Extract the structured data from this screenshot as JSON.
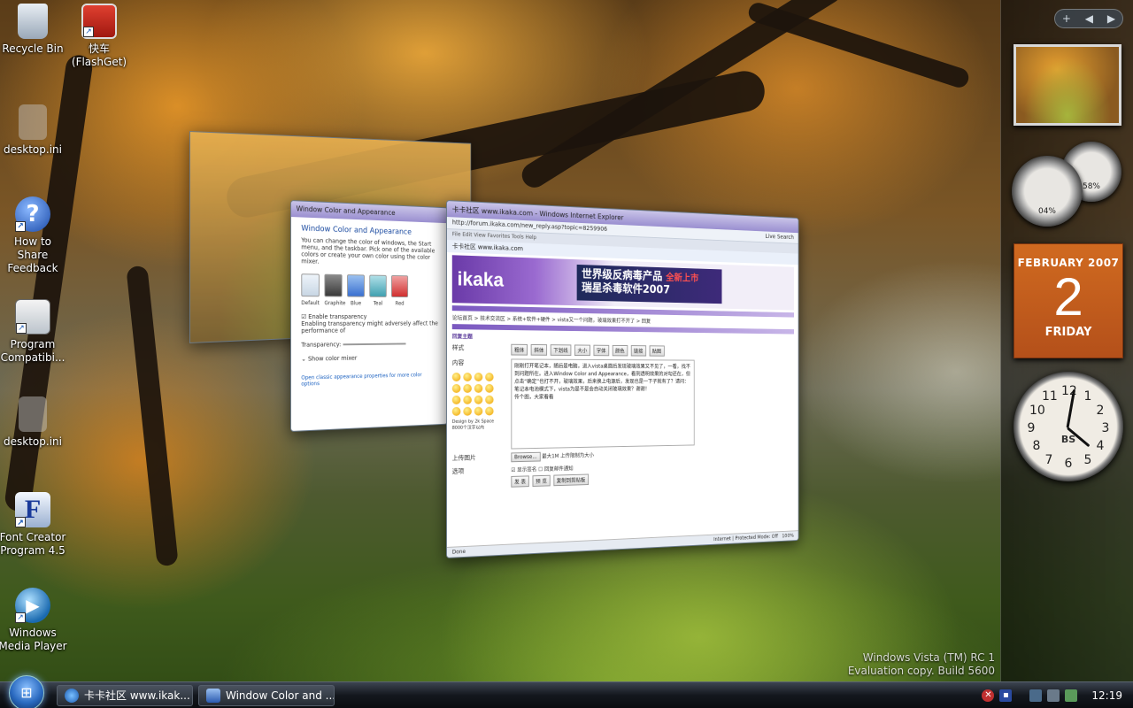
{
  "desktop": {
    "icons": [
      {
        "label": "Recycle Bin",
        "icon": "recycle-bin-icon"
      },
      {
        "label": "快车\n(FlashGet)",
        "icon": "flashget-icon"
      },
      {
        "label": "desktop.ini",
        "icon": "ini-file-icon"
      },
      {
        "label": "How to Share\nFeedback",
        "icon": "help-icon"
      },
      {
        "label": "Program\nCompatibi...",
        "icon": "compatibility-icon"
      },
      {
        "label": "desktop.ini",
        "icon": "ini-file-icon"
      },
      {
        "label": "Font Creator\nProgram 4.5",
        "icon": "font-creator-icon"
      },
      {
        "label": "Windows\nMedia Player",
        "icon": "media-player-icon"
      }
    ],
    "watermark": {
      "line1": "Windows Vista (TM) RC 1",
      "line2": "Evaluation copy. Build 5600"
    }
  },
  "sidebar": {
    "controls": {
      "add": "+",
      "prev": "◀",
      "next": "▶"
    },
    "gauges": {
      "cpu": "04%",
      "memory": "58%"
    },
    "calendar": {
      "month": "FEBRUARY 2007",
      "day": "2",
      "weekday": "FRIDAY"
    },
    "clock": {
      "brand": "BS",
      "numbers": [
        "12",
        "1",
        "2",
        "3",
        "4",
        "5",
        "6",
        "7",
        "8",
        "9",
        "10",
        "11"
      ]
    }
  },
  "flip_windows": {
    "color_appearance": {
      "title": "Window Color and Appearance",
      "heading": "Window Color and Appearance",
      "desc": "You can change the color of windows, the Start menu, and the taskbar. Pick one of the available colors or create your own color using the color mixer.",
      "swatches": [
        "Default",
        "Graphite",
        "Blue",
        "Teal",
        "Red"
      ],
      "transparency_label": "Enable transparency",
      "transparency_warning": "Enabling transparency might adversely affect the performance of",
      "transparency": "Transparency:",
      "mixer": "Show color mixer",
      "classic_link": "Open classic appearance properties for more color options"
    },
    "ie": {
      "title": "卡卡社区 www.ikaka.com - Windows Internet Explorer",
      "url": "http://forum.ikaka.com/new_reply.asp?topic=8259906",
      "search": "Live Search",
      "menu": "File  Edit  View  Favorites  Tools  Help",
      "tab": "卡卡社区 www.ikaka.com",
      "logo": "ikaka",
      "ad_line1": "世界级反病毒产品",
      "ad_line2": "瑞星杀毒软件2007",
      "ad_tag": "全新上市",
      "breadcrumb": "论坛首页 > 技术交流区 > 系统+软件+硬件 > vista又一个问题，玻璃效果打不开了 > 回复",
      "section": "回复主题",
      "style_label": "样式",
      "content_label": "内容",
      "upload_label": "上传图片",
      "options_label": "选项",
      "toolbar_buttons": [
        "粗体",
        "斜体",
        "下划线",
        "大小",
        "字体",
        "颜色",
        "链接",
        "贴图"
      ],
      "post_text": "刚刚打开笔记本，随后是电脑，进入vista桌面后发现玻璃效果又不见了，一看，找不到问题所在。进入Window Color and Appearance，看到透明效果的对勾还在，但点击“确定”也打不开，玻璃效果，后来换上电源后，发现也是一下子就有了？请问：笔记本电池模式下，vista为是不是会自动关闭玻璃效果？谢谢！",
      "post_text2": "传个图，大家看看",
      "design_credit": "Design by 2k Space",
      "char_limit": "8000个汉字以内",
      "browse": "Browse...",
      "upload_hint": "最大1M 上传限制为大小",
      "check_preview": "显示签名",
      "check_notify": "回复邮件通知",
      "submit": "发 表",
      "preview": "预 览",
      "copy": "复制到剪贴板",
      "status": "Done",
      "zone": "Internet | Protected Mode: Off",
      "zoom": "100%"
    }
  },
  "taskbar": {
    "start_icon": "windows-orb-icon",
    "items": [
      {
        "label": "卡卡社区 www.ikak...",
        "icon": "ie-icon"
      },
      {
        "label": "Window Color and ...",
        "icon": "control-panel-icon"
      }
    ],
    "time": "12:19"
  },
  "colors": {
    "calendar": "#c05a1c",
    "ikaka_purple": "#7a58c0"
  }
}
